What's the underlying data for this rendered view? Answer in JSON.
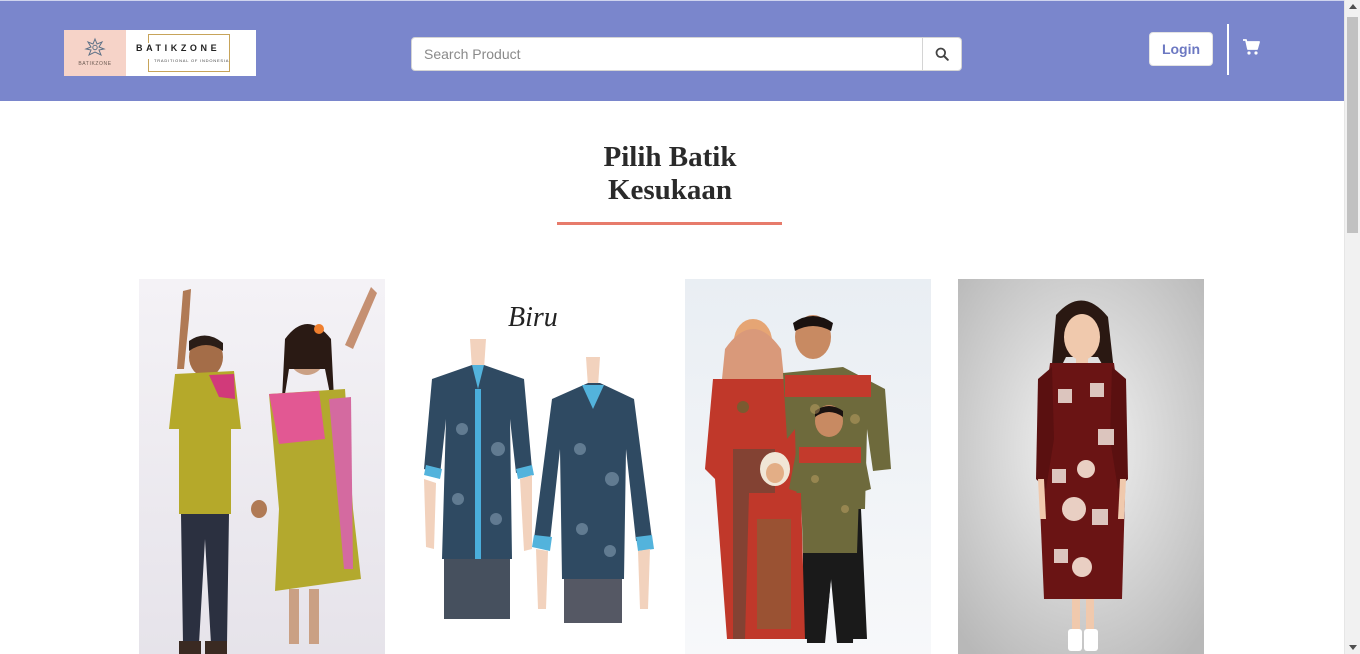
{
  "header": {
    "logo": {
      "brand_text": "BATIKZONE",
      "tagline": "TRADITIONAL OF INDONESIA",
      "mark_text": "BATIKZONE"
    },
    "search": {
      "placeholder": "Search Product",
      "button_icon": "search-icon"
    },
    "login_label": "Login",
    "cart_icon": "cart-icon",
    "background_color": "#7a86cc"
  },
  "main": {
    "heading_line1": "Pilih Batik",
    "heading_line2": "Kesukaan",
    "accent_color": "#e77b6b",
    "products": [
      {
        "image": "children-batik-pair-photo"
      },
      {
        "image": "blue-batik-shirts-photo",
        "overlay_text": "Biru"
      },
      {
        "image": "family-batik-set-photo"
      },
      {
        "image": "red-batik-dress-photo"
      }
    ]
  }
}
